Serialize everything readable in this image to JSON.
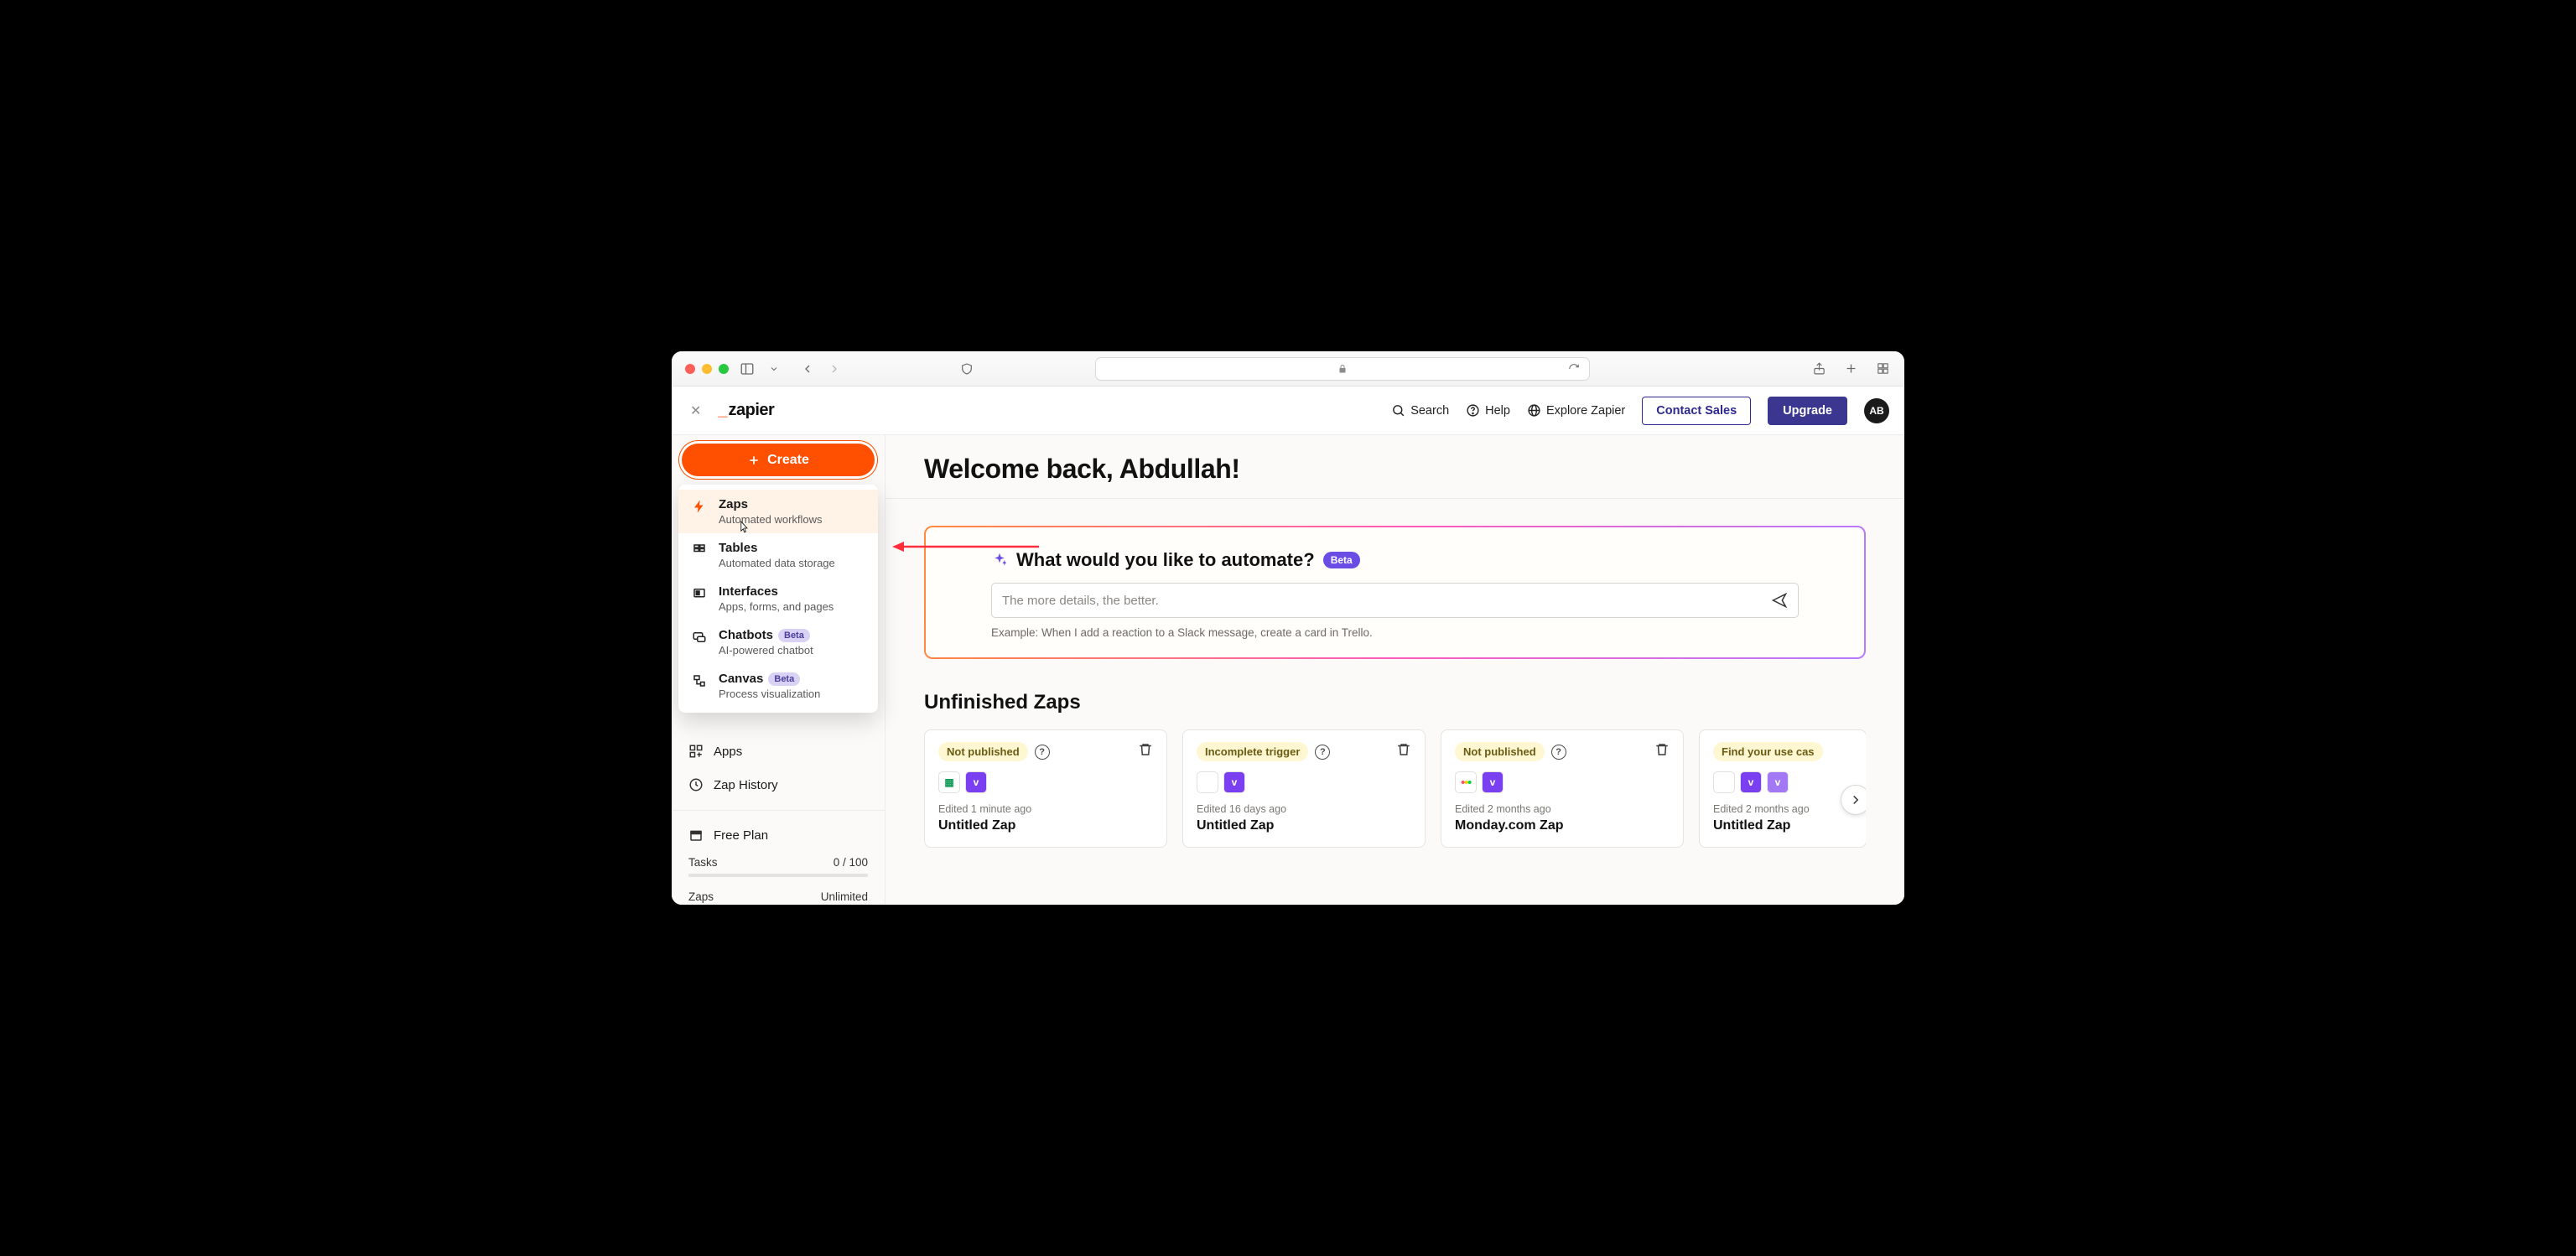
{
  "header": {
    "search_label": "Search",
    "help_label": "Help",
    "explore_label": "Explore Zapier",
    "contact_label": "Contact Sales",
    "upgrade_label": "Upgrade",
    "avatar_initials": "AB",
    "logo_prefix": "_",
    "logo_word": "zapier"
  },
  "sidebar": {
    "create_label": "Create",
    "menu": [
      {
        "title": "Zaps",
        "desc": "Automated workflows",
        "icon": "lightning",
        "beta": false,
        "highlight": true
      },
      {
        "title": "Tables",
        "desc": "Automated data storage",
        "icon": "tables",
        "beta": false,
        "highlight": false
      },
      {
        "title": "Interfaces",
        "desc": "Apps, forms, and pages",
        "icon": "interfaces",
        "beta": false,
        "highlight": false
      },
      {
        "title": "Chatbots",
        "desc": "AI-powered chatbot",
        "icon": "chat",
        "beta": true,
        "highlight": false
      },
      {
        "title": "Canvas",
        "desc": "Process visualization",
        "icon": "canvas",
        "beta": true,
        "highlight": false
      }
    ],
    "beta_text": "Beta",
    "apps_label": "Apps",
    "history_label": "Zap History",
    "plan_label": "Free Plan",
    "tasks_label": "Tasks",
    "tasks_value": "0 / 100",
    "zaps_label": "Zaps",
    "zaps_value": "Unlimited"
  },
  "main": {
    "page_title": "Welcome back, Abdullah!",
    "automate": {
      "heading": "What would you like to automate?",
      "beta_label": "Beta",
      "placeholder": "The more details, the better.",
      "example": "Example: When I add a reaction to a Slack message, create a card in Trello."
    },
    "unfinished_title": "Unfinished Zaps",
    "zaps": [
      {
        "status": "Not published",
        "edited": "Edited 1 minute ago",
        "name": "Untitled Zap",
        "chips": [
          "sheets",
          "purple"
        ]
      },
      {
        "status": "Incomplete trigger",
        "edited": "Edited 16 days ago",
        "name": "Untitled Zap",
        "chips": [
          "empty",
          "purple"
        ]
      },
      {
        "status": "Not published",
        "edited": "Edited 2 months ago",
        "name": "Monday.com Zap",
        "chips": [
          "multi",
          "purple"
        ]
      },
      {
        "status": "Find your use cas",
        "edited": "Edited 2 months ago",
        "name": "Untitled Zap",
        "chips": [
          "empty",
          "purple",
          "purple"
        ]
      }
    ]
  }
}
